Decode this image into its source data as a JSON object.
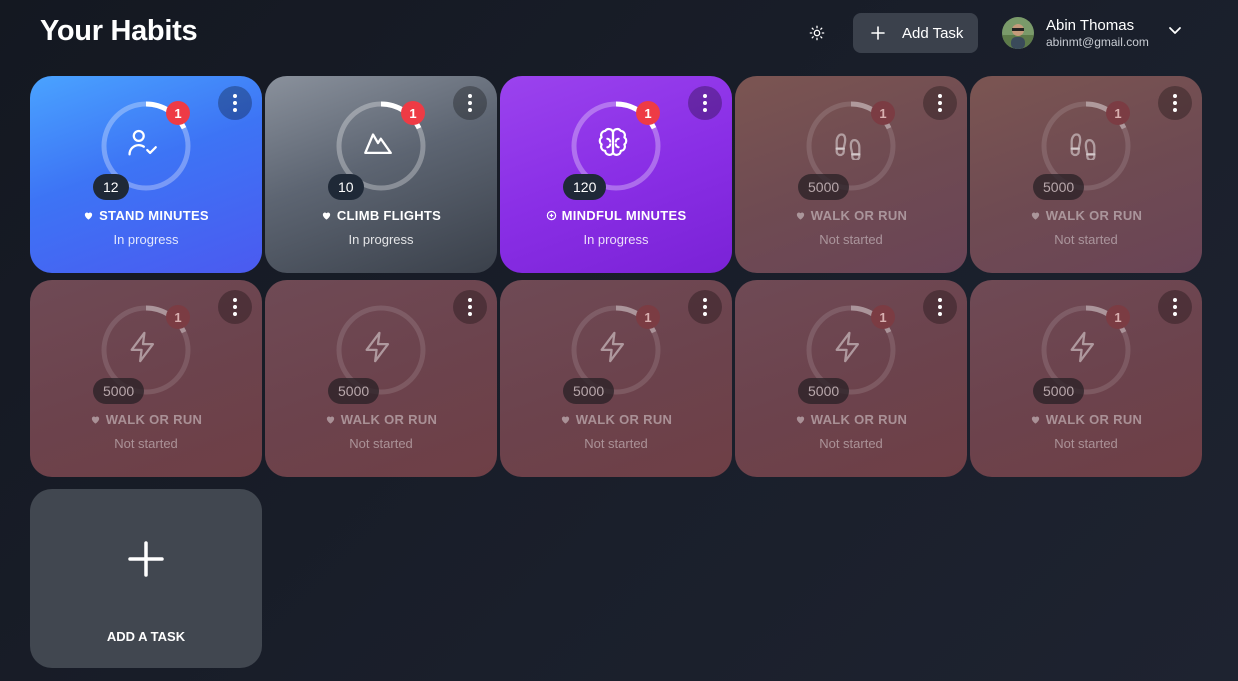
{
  "header": {
    "title": "Your Habits",
    "add_task_label": "Add Task",
    "user_name": "Abin Thomas",
    "user_email": "abinmt@gmail.com"
  },
  "habits": [
    {
      "name": "STAND MINUTES",
      "status": "In progress",
      "count": "12",
      "badge": "1",
      "icon": "person-check-icon",
      "category_icon": "heart-icon",
      "style": "blue",
      "progress": 0.18
    },
    {
      "name": "CLIMB FLIGHTS",
      "status": "In progress",
      "count": "10",
      "badge": "1",
      "icon": "mountain-icon",
      "category_icon": "heart-icon",
      "style": "gray",
      "progress": 0.18
    },
    {
      "name": "MINDFUL MINUTES",
      "status": "In progress",
      "count": "120",
      "badge": "1",
      "icon": "brain-icon",
      "category_icon": "mind-icon",
      "style": "purple",
      "progress": 0.18
    },
    {
      "name": "WALK OR RUN",
      "status": "Not started",
      "count": "5000",
      "badge": "1",
      "icon": "footprints-icon",
      "category_icon": "heart-icon",
      "style": "brown",
      "progress": 0.18
    },
    {
      "name": "WALK OR RUN",
      "status": "Not started",
      "count": "5000",
      "badge": "1",
      "icon": "footprints-icon",
      "category_icon": "heart-icon",
      "style": "brown",
      "progress": 0.18
    },
    {
      "name": "WALK OR RUN",
      "status": "Not started",
      "count": "5000",
      "badge": "1",
      "icon": "bolt-icon",
      "category_icon": "heart-icon",
      "style": "red",
      "progress": 0.18
    },
    {
      "name": "WALK OR RUN",
      "status": "Not started",
      "count": "5000",
      "badge": "",
      "icon": "bolt-icon",
      "category_icon": "heart-icon",
      "style": "red",
      "progress": 0.0
    },
    {
      "name": "WALK OR RUN",
      "status": "Not started",
      "count": "5000",
      "badge": "1",
      "icon": "bolt-icon",
      "category_icon": "heart-icon",
      "style": "red",
      "progress": 0.18
    },
    {
      "name": "WALK OR RUN",
      "status": "Not started",
      "count": "5000",
      "badge": "1",
      "icon": "bolt-icon",
      "category_icon": "heart-icon",
      "style": "red",
      "progress": 0.18
    },
    {
      "name": "WALK OR RUN",
      "status": "Not started",
      "count": "5000",
      "badge": "1",
      "icon": "bolt-icon",
      "category_icon": "heart-icon",
      "style": "red",
      "progress": 0.18
    }
  ],
  "add_card_label": "ADD A TASK"
}
